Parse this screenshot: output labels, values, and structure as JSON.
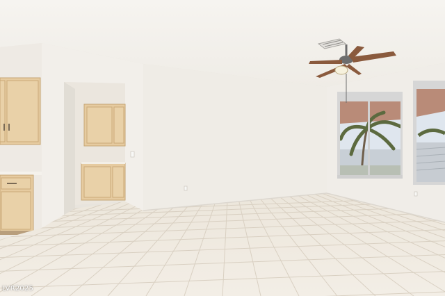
{
  "watermark": "LVR2025",
  "palette": {
    "ceiling": "#f4f1ec",
    "wall": "#efece6",
    "wall_shadow": "#e6e2db",
    "floor_tile": "#efe9de",
    "grout": "#d8cfc1",
    "cabinet": "#e8cfa4",
    "cabinet_edge": "#c9a977",
    "window_frame": "#d9d9d9",
    "sky": "#dfe6ee",
    "awning": "#b98b78",
    "palm": "#5c6a3f",
    "fan_blade": "#8a5a3d",
    "fan_metal": "#6d6d6d"
  }
}
